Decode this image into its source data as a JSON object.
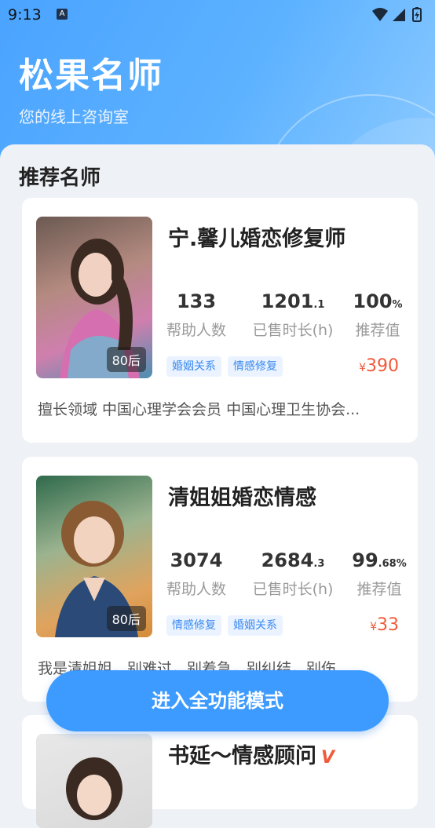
{
  "status_bar": {
    "time": "9:13",
    "notif_letter": "A"
  },
  "hero": {
    "title": "松果名师",
    "subtitle": "您的线上咨询室"
  },
  "section_title": "推荐名师",
  "teachers": [
    {
      "name": "宁.馨儿婚恋修复师",
      "age": "80后",
      "stats": [
        {
          "num": "133",
          "dec": "",
          "label": "帮助人数"
        },
        {
          "num": "1201",
          "dec": ".1",
          "label": "已售时长(h)"
        },
        {
          "num": "100",
          "dec": "%",
          "label": "推荐值"
        }
      ],
      "tags": [
        "婚姻关系",
        "情感修复"
      ],
      "price_symbol": "¥",
      "price": "390",
      "desc": "擅长领域 中国心理学会会员 中国心理卫生协会..."
    },
    {
      "name": "清姐姐婚恋情感",
      "age": "80后",
      "stats": [
        {
          "num": "3074",
          "dec": "",
          "label": "帮助人数"
        },
        {
          "num": "2684",
          "dec": ".3",
          "label": "已售时长(h)"
        },
        {
          "num": "99",
          "dec": ".68%",
          "label": "推荐值"
        }
      ],
      "tags": [
        "情感修复",
        "婚姻关系"
      ],
      "price_symbol": "¥",
      "price": "33",
      "desc": "我是清姐姐，别难过，别着急，别纠结，别伤..."
    },
    {
      "name": "书延～情感顾问",
      "verified_mark": "V"
    }
  ],
  "cta_label": "进入全功能模式",
  "colors": {
    "accent": "#3d9bff",
    "price": "#f2593a",
    "tag_bg": "#eaf3ff",
    "tag_text": "#3b8af0"
  }
}
